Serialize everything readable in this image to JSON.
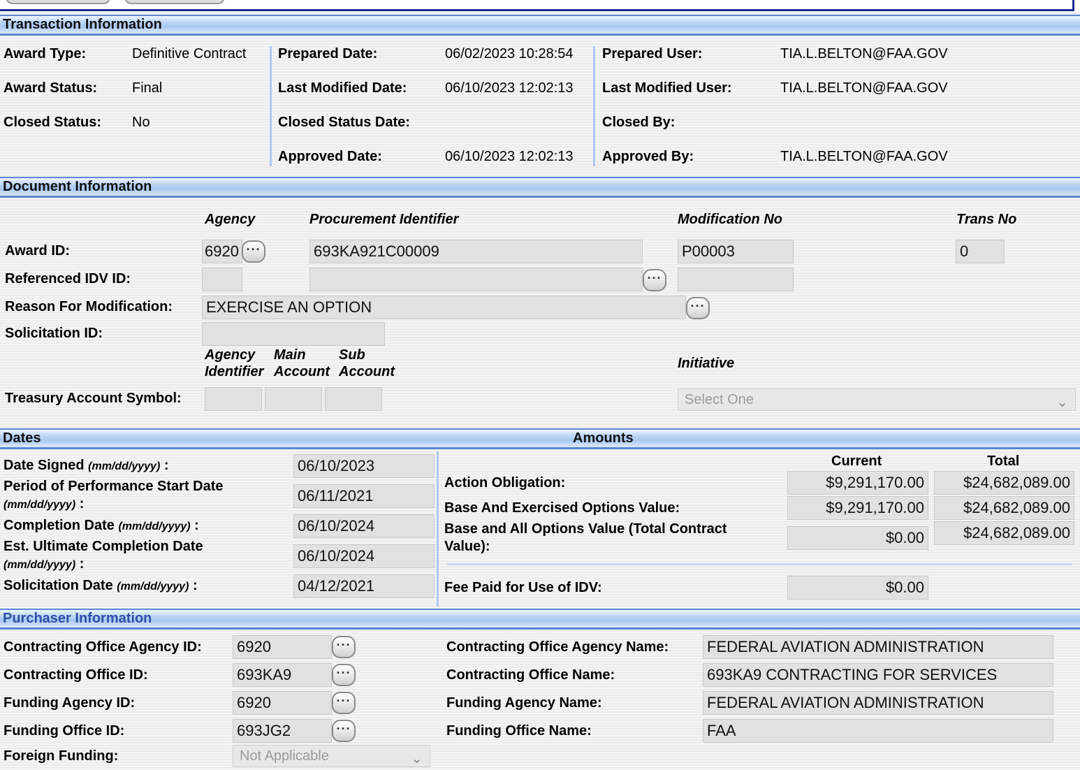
{
  "transaction": {
    "title": "Transaction Information",
    "award_type_label": "Award Type:",
    "award_type": "Definitive Contract",
    "award_status_label": "Award Status:",
    "award_status": "Final",
    "closed_status_label": "Closed Status:",
    "closed_status": "No",
    "prepared_date_label": "Prepared Date:",
    "prepared_date": "06/02/2023 10:28:54",
    "last_modified_date_label": "Last Modified Date:",
    "last_modified_date": "06/10/2023 12:02:13",
    "closed_status_date_label": "Closed Status Date:",
    "approved_date_label": "Approved Date:",
    "approved_date": "06/10/2023 12:02:13",
    "prepared_user_label": "Prepared User:",
    "prepared_user": "TIA.L.BELTON@FAA.GOV",
    "last_modified_user_label": "Last Modified User:",
    "last_modified_user": "TIA.L.BELTON@FAA.GOV",
    "closed_by_label": "Closed By:",
    "approved_by_label": "Approved By:",
    "approved_by": "TIA.L.BELTON@FAA.GOV"
  },
  "document": {
    "title": "Document Information",
    "col_agency": "Agency",
    "col_procurement": "Procurement Identifier",
    "col_modification": "Modification No",
    "col_trans": "Trans No",
    "award_id_label": "Award ID:",
    "award_agency": "6920",
    "award_piid": "693KA921C00009",
    "award_mod": "P00003",
    "award_trans": "0",
    "ref_idv_label": "Referenced IDV ID:",
    "ref_idv_agency": "",
    "ref_idv_piid": "",
    "ref_idv_mod": "",
    "reason_label": "Reason For Modification:",
    "reason": "EXERCISE AN OPTION",
    "solicitation_label": "Solicitation ID:",
    "solicitation": "",
    "tas_h1a": "Agency",
    "tas_h1b": "Identifier",
    "tas_h2a": "Main",
    "tas_h2b": "Account",
    "tas_h3a": "Sub",
    "tas_h3b": "Account",
    "initiative_label": "Initiative",
    "tas_label": "Treasury Account Symbol:",
    "tas_agency": "",
    "tas_main": "",
    "tas_sub": "",
    "initiative_value": "Select One"
  },
  "dates": {
    "title": "Dates",
    "date_signed_label": "Date Signed",
    "fmt": "(mm/dd/yyyy)",
    "colon": ":",
    "date_signed": "06/10/2023",
    "pop_start_label": "Period of Performance Start Date",
    "pop_start": "06/11/2021",
    "completion_label": "Completion Date",
    "completion": "06/10/2024",
    "est_ult_label": "Est. Ultimate Completion Date",
    "est_ult": "06/10/2024",
    "solicitation_date_label": "Solicitation Date",
    "solicitation_date": "04/12/2021"
  },
  "amounts": {
    "title": "Amounts",
    "col_current": "Current",
    "col_total": "Total",
    "action_obligation_label": "Action Obligation:",
    "action_obligation_current": "$9,291,170.00",
    "action_obligation_total": "$24,682,089.00",
    "base_exercised_label": "Base And Exercised Options Value:",
    "base_exercised_current": "$9,291,170.00",
    "base_exercised_total": "$24,682,089.00",
    "base_all_label_1": "Base and All Options Value (Total Contract",
    "base_all_label_2": "Value):",
    "base_all_current": "$0.00",
    "base_all_total": "$24,682,089.00",
    "fee_idv_label": "Fee Paid for Use of IDV:",
    "fee_idv": "$0.00"
  },
  "purchaser": {
    "title": "Purchaser Information",
    "co_agency_id_label": "Contracting Office Agency ID:",
    "co_agency_id": "6920",
    "co_id_label": "Contracting Office ID:",
    "co_id": "693KA9",
    "funding_agency_id_label": "Funding Agency ID:",
    "funding_agency_id": "6920",
    "funding_office_id_label": "Funding Office ID:",
    "funding_office_id": "693JG2",
    "foreign_funding_label": "Foreign Funding:",
    "foreign_funding": "Not Applicable",
    "co_agency_name_label": "Contracting Office Agency Name:",
    "co_agency_name": "FEDERAL AVIATION ADMINISTRATION",
    "co_name_label": "Contracting Office Name:",
    "co_name": "693KA9 CONTRACTING FOR SERVICES",
    "funding_agency_name_label": "Funding Agency Name:",
    "funding_agency_name": "FEDERAL AVIATION ADMINISTRATION",
    "funding_office_name_label": "Funding Office Name:",
    "funding_office_name": "FAA"
  },
  "icons": {
    "lookup": "ellipsis-icon",
    "dropdown": "chevron-down-icon"
  }
}
